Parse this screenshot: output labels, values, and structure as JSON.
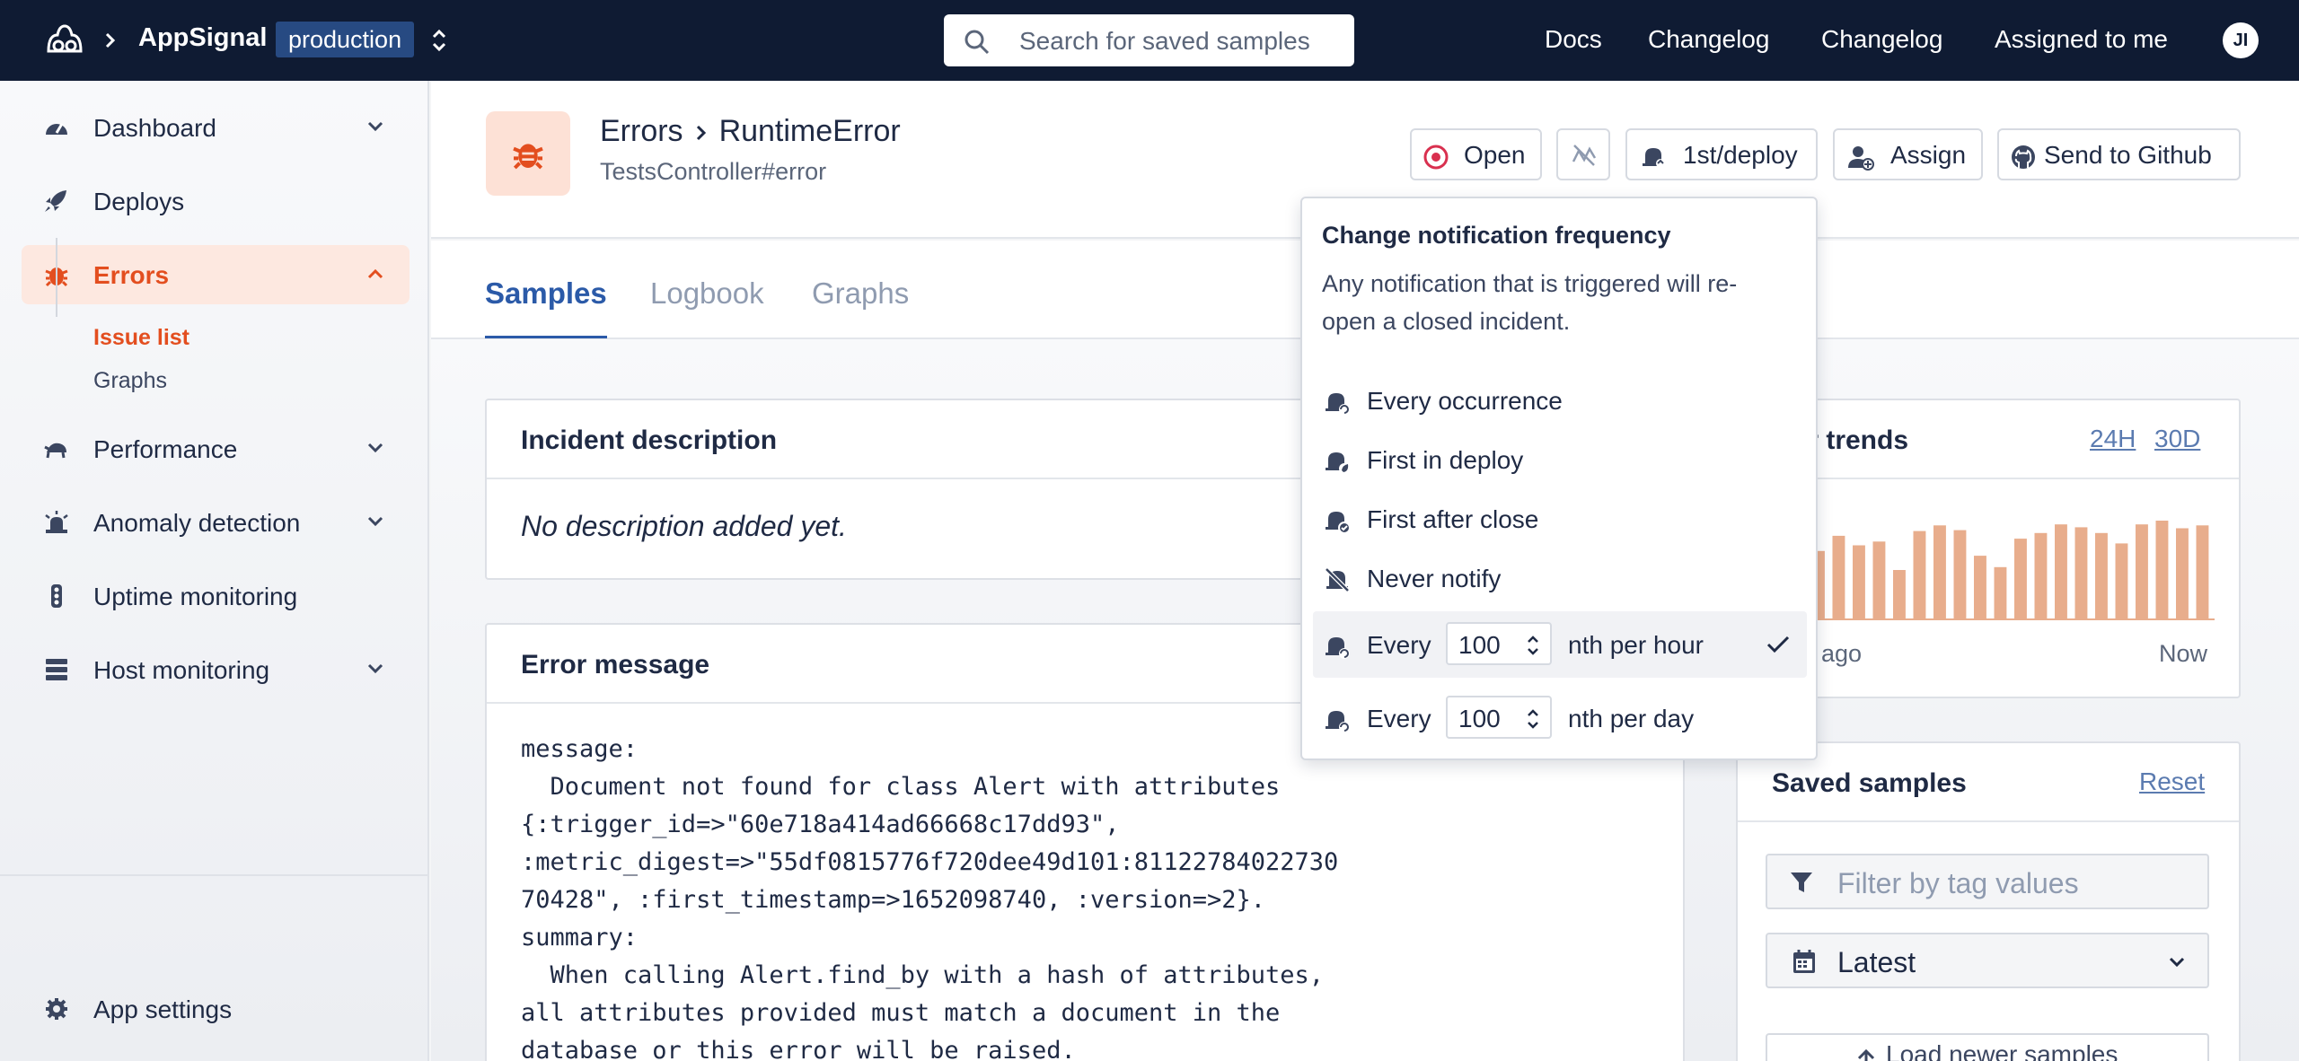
{
  "topnav": {
    "app_name": "AppSignal",
    "environment": "production",
    "search_placeholder": "Search for saved samples",
    "links": [
      "Docs",
      "Changelog",
      "Changelog",
      "Assigned to me"
    ],
    "avatar_initials": "JI"
  },
  "sidebar": {
    "items": [
      {
        "label": "Dashboard",
        "icon": "gauge-icon"
      },
      {
        "label": "Deploys",
        "icon": "rocket-icon"
      },
      {
        "label": "Errors",
        "icon": "bug-icon"
      },
      {
        "label": "Performance",
        "icon": "turtle-icon"
      },
      {
        "label": "Anomaly detection",
        "icon": "alarm-icon"
      },
      {
        "label": "Uptime monitoring",
        "icon": "traffic-light-icon"
      },
      {
        "label": "Host monitoring",
        "icon": "server-icon"
      }
    ],
    "error_subitems": [
      "Issue list",
      "Graphs"
    ],
    "footer": "App settings"
  },
  "header": {
    "section": "Errors",
    "title": "RuntimeError",
    "subtitle": "TestsController#error",
    "buttons": {
      "open": "Open",
      "notify": "1st/deploy",
      "assign": "Assign",
      "github": "Send to Github"
    }
  },
  "tabs": [
    "Samples",
    "Logbook",
    "Graphs"
  ],
  "incident": {
    "title": "Incident description",
    "body": "No description added yet."
  },
  "error_message": {
    "title": "Error message",
    "lines": [
      "message:",
      "  Document not found for class Alert with attributes",
      "{:trigger_id=>\"60e718a414ad66668c17dd93\",",
      ":metric_digest=>\"55df0815776f720dee49d101:81122784022730",
      "70428\", :first_timestamp=>1652098740, :version=>2}.",
      "summary:",
      "  When calling Alert.find_by with a hash of attributes,",
      "all attributes provided must match a document in the",
      "database or this error will be raised."
    ]
  },
  "trends": {
    "title": "or trends",
    "range_24h": "24H",
    "range_30d": "30D",
    "x_start": "ago",
    "x_end": "Now"
  },
  "chart_data": {
    "type": "bar",
    "color": "#e8ad8c",
    "values": [
      0.72,
      0.88,
      0.78,
      0.82,
      0.52,
      0.93,
      0.99,
      0.94,
      0.67,
      0.55,
      0.85,
      0.91,
      1.0,
      0.97,
      0.91,
      0.8,
      1.0,
      1.04,
      0.96,
      0.99
    ]
  },
  "saved_samples": {
    "title": "Saved samples",
    "reset": "Reset",
    "filter_placeholder": "Filter by tag values",
    "sort": "Latest",
    "load_newer": "Load newer samples"
  },
  "dropdown": {
    "title": "Change notification frequency",
    "description": "Any notification that is triggered will re-open a closed incident.",
    "options": [
      "Every occurrence",
      "First in deploy",
      "First after close",
      "Never notify"
    ],
    "every_label": "Every",
    "per_hour_value": "100",
    "per_hour_suffix": "nth per hour",
    "per_day_value": "100",
    "per_day_suffix": "nth per day"
  },
  "colors": {
    "nav_bg": "#0f1b33",
    "accent_error": "#e34e1f",
    "link_blue": "#2b5aa8",
    "open_red": "#d9304f"
  }
}
